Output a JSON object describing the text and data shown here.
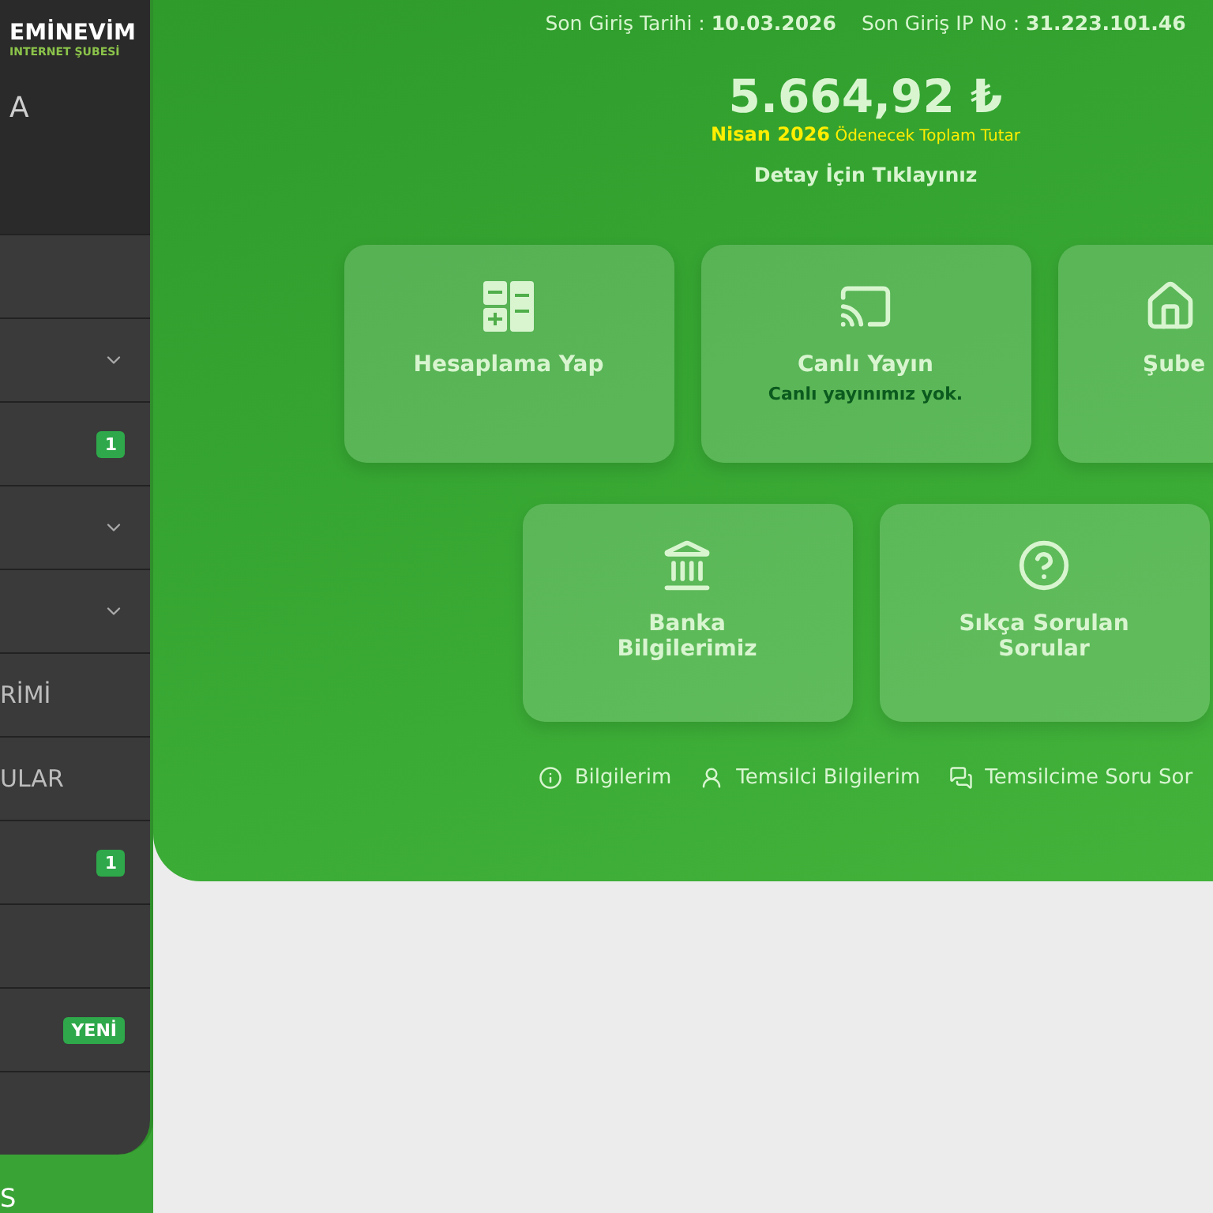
{
  "logo": {
    "name": "EMİNEVİM",
    "subtitle": "INTERNET ŞUBESİ"
  },
  "sidebar": {
    "user": "A",
    "items": [
      {
        "kind": "plain"
      },
      {
        "kind": "dropdown"
      },
      {
        "kind": "badge",
        "badge": "1"
      },
      {
        "kind": "dropdown"
      },
      {
        "kind": "dropdown"
      },
      {
        "kind": "plain",
        "label": "RİMİ"
      },
      {
        "kind": "plain",
        "label": "ULAR"
      },
      {
        "kind": "badge",
        "badge": "1"
      },
      {
        "kind": "plain"
      },
      {
        "kind": "badge",
        "badge": "YENİ"
      },
      {
        "kind": "plain"
      }
    ],
    "bottom_item": "S"
  },
  "login_info": [
    {
      "label": "Son Giriş Tarihi :",
      "value": "10.03.2026"
    },
    {
      "label": "Son Giriş IP No :",
      "value": "31.223.101.46"
    }
  ],
  "balance": {
    "amount": "5.664,92 ₺",
    "period": "Nisan 2026",
    "caption": "Ödenecek Toplam Tutar",
    "detail_link": "Detay İçin Tıklayınız"
  },
  "cards": [
    {
      "title": "Hesaplama Yap"
    },
    {
      "title": "Canlı Yayın",
      "subtitle": "Canlı yayınımız yok."
    },
    {
      "title": "Şube"
    },
    {
      "title": "Banka Bilgilerimiz"
    },
    {
      "title": "Sıkça Sorulan Sorular"
    }
  ],
  "links": [
    {
      "label": "Bilgilerim"
    },
    {
      "label": "Temsilci Bilgilerim"
    },
    {
      "label": "Temsilcime Soru Sor"
    }
  ]
}
